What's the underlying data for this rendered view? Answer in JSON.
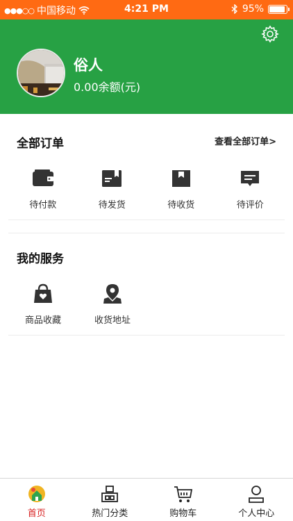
{
  "status": {
    "carrier": "中国移动",
    "time": "4:21 PM",
    "battery": "95%",
    "battery_level": 0.95
  },
  "profile": {
    "name": "俗人",
    "balance": "0.00余额(元)"
  },
  "orders": {
    "title": "全部订单",
    "view_all": "查看全部订单>",
    "items": [
      {
        "label": "待付款",
        "icon": "wallet-icon"
      },
      {
        "label": "待发货",
        "icon": "box-icon"
      },
      {
        "label": "待收货",
        "icon": "package-icon"
      },
      {
        "label": "待评价",
        "icon": "comment-icon"
      }
    ]
  },
  "services": {
    "title": "我的服务",
    "items": [
      {
        "label": "商品收藏",
        "icon": "favorite-bag-icon"
      },
      {
        "label": "收货地址",
        "icon": "location-icon"
      }
    ]
  },
  "tabs": [
    {
      "label": "首页",
      "icon": "home-icon",
      "active": true
    },
    {
      "label": "热门分类",
      "icon": "category-icon",
      "active": false
    },
    {
      "label": "购物车",
      "icon": "cart-icon",
      "active": false
    },
    {
      "label": "个人中心",
      "icon": "user-icon",
      "active": false
    }
  ],
  "colors": {
    "status_bar": "#ff6a13",
    "header": "#27a144",
    "active_tab": "#d72020"
  }
}
